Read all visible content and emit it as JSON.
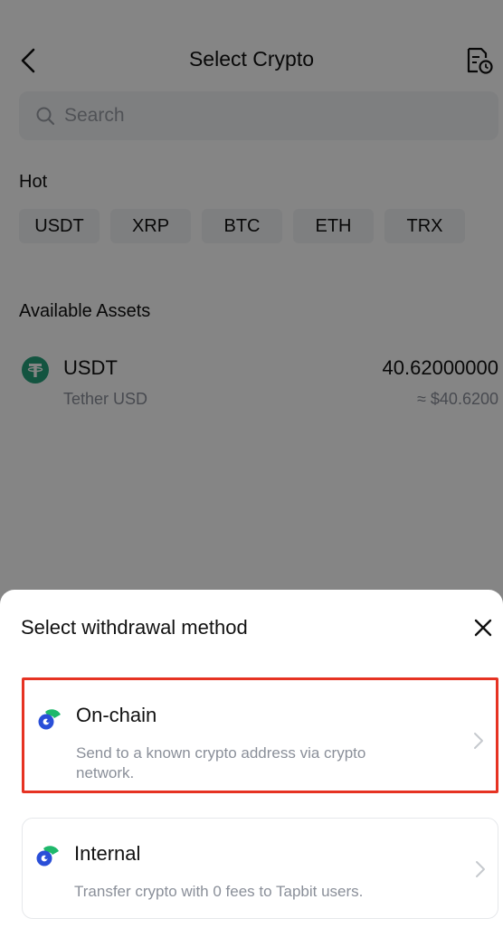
{
  "header": {
    "title": "Select Crypto",
    "back_icon": "chevron-left-icon",
    "history_icon": "document-clock-icon"
  },
  "search": {
    "placeholder": "Search",
    "value": ""
  },
  "hot": {
    "label": "Hot",
    "items": [
      "USDT",
      "XRP",
      "BTC",
      "ETH",
      "TRX"
    ]
  },
  "assets": {
    "label": "Available Assets",
    "items": [
      {
        "symbol": "USDT",
        "name": "Tether USD",
        "amount": "40.62000000",
        "value": "≈ $40.6200",
        "icon": "tether-icon",
        "icon_color": "#26a17b"
      }
    ]
  },
  "sheet": {
    "title": "Select withdrawal method",
    "close_icon": "close-icon",
    "methods": [
      {
        "title": "On-chain",
        "description": "Send to a known crypto address via crypto network.",
        "icon": "tapbit-icon",
        "highlighted": true
      },
      {
        "title": "Internal",
        "description": "Transfer crypto with 0 fees to Tapbit users.",
        "icon": "tapbit-icon",
        "highlighted": false
      }
    ]
  },
  "colors": {
    "highlight": "#e63323",
    "brand_green": "#1fb86b",
    "brand_blue": "#2a4fd8",
    "muted_text": "#8a8f99"
  }
}
